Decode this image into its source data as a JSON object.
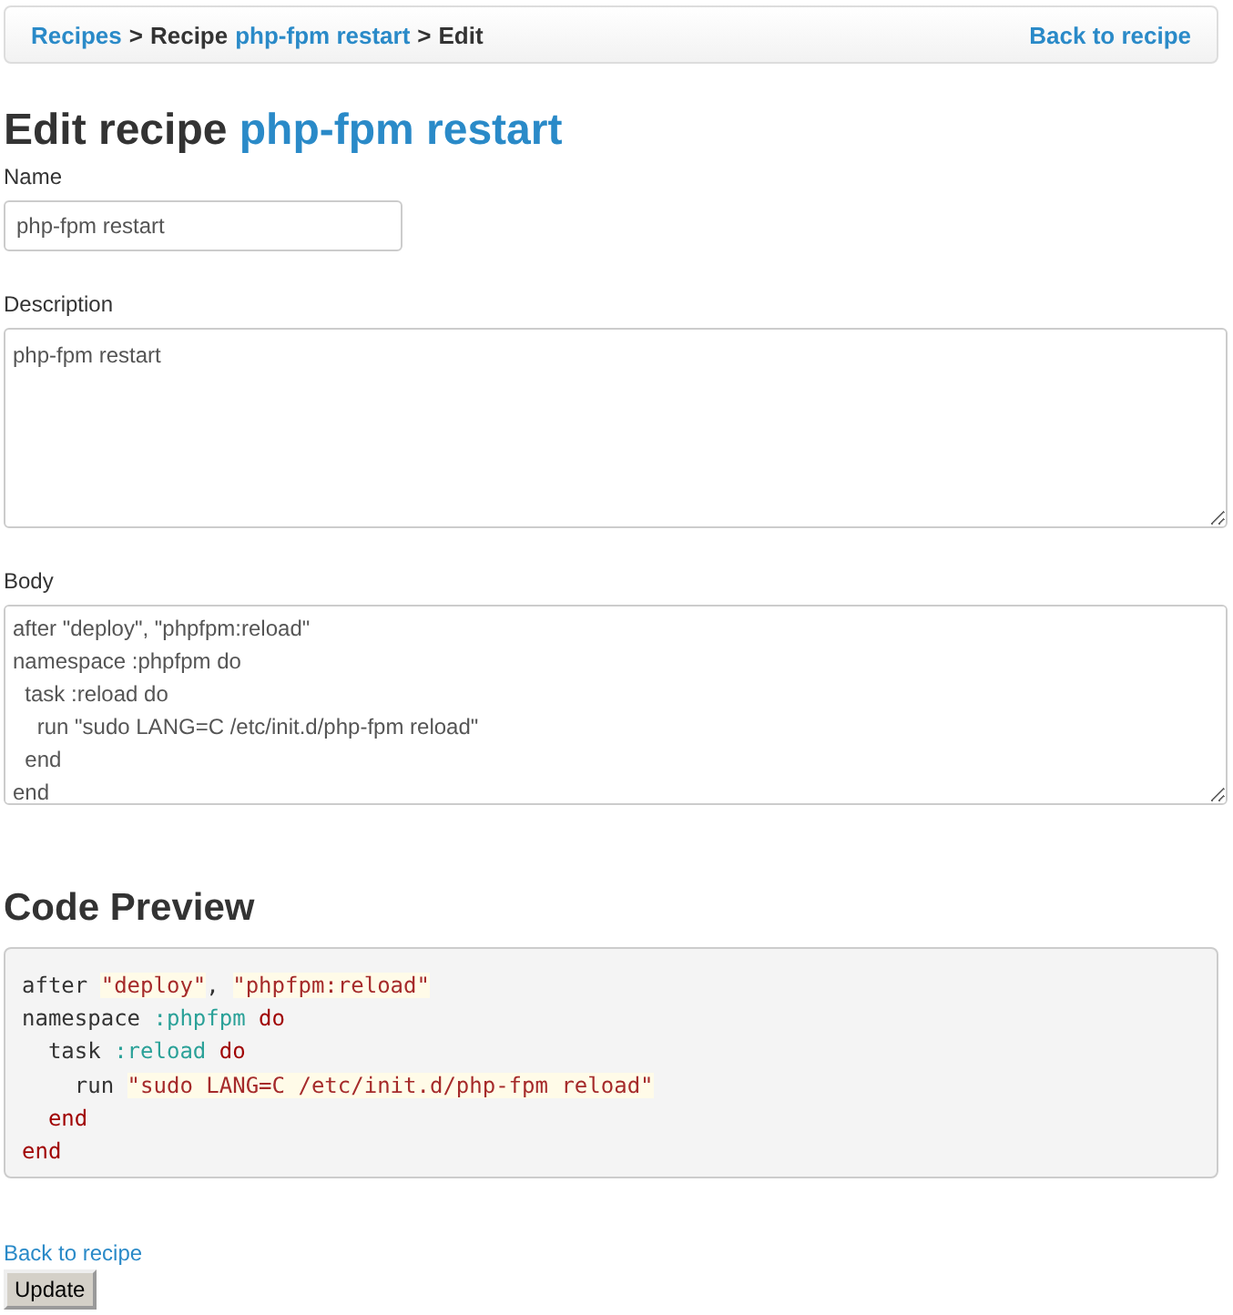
{
  "breadcrumb": {
    "items": [
      {
        "text": "Recipes",
        "kind": "link"
      },
      {
        "text": ">",
        "kind": "sep"
      },
      {
        "text": "Recipe",
        "kind": "text"
      },
      {
        "text": "php-fpm restart",
        "kind": "link"
      },
      {
        "text": ">",
        "kind": "sep"
      },
      {
        "text": "Edit",
        "kind": "text"
      }
    ],
    "back_link": "Back to recipe"
  },
  "heading": {
    "prefix": "Edit recipe",
    "name": "php-fpm restart"
  },
  "name_field": {
    "label": "Name",
    "value": "php-fpm restart"
  },
  "description_field": {
    "label": "Description",
    "value": "php-fpm restart"
  },
  "body_field": {
    "label": "Body",
    "value": "after \"deploy\", \"phpfpm:reload\"\nnamespace :phpfpm do\n  task :reload do\n    run \"sudo LANG=C /etc/init.d/php-fpm reload\"\n  end\nend"
  },
  "preview": {
    "title": "Code Preview",
    "lines": [
      [
        {
          "kind": "plain",
          "text": "after "
        },
        {
          "kind": "string",
          "text": "\"deploy\""
        },
        {
          "kind": "plain",
          "text": ", "
        },
        {
          "kind": "string",
          "text": "\"phpfpm:reload\""
        }
      ],
      [
        {
          "kind": "plain",
          "text": "namespace "
        },
        {
          "kind": "symbol",
          "text": ":phpfpm"
        },
        {
          "kind": "keyword",
          "text": " do"
        }
      ],
      [
        {
          "kind": "plain",
          "text": "  task "
        },
        {
          "kind": "symbol",
          "text": ":reload"
        },
        {
          "kind": "keyword",
          "text": " do"
        }
      ],
      [
        {
          "kind": "plain",
          "text": "    run "
        },
        {
          "kind": "string",
          "text": "\"sudo LANG=C /etc/init.d/php-fpm reload\""
        }
      ],
      [
        {
          "kind": "keyword",
          "text": "  end"
        }
      ],
      [
        {
          "kind": "keyword",
          "text": "end"
        }
      ]
    ]
  },
  "back_link": "Back to recipe",
  "submit_button": "Update"
}
